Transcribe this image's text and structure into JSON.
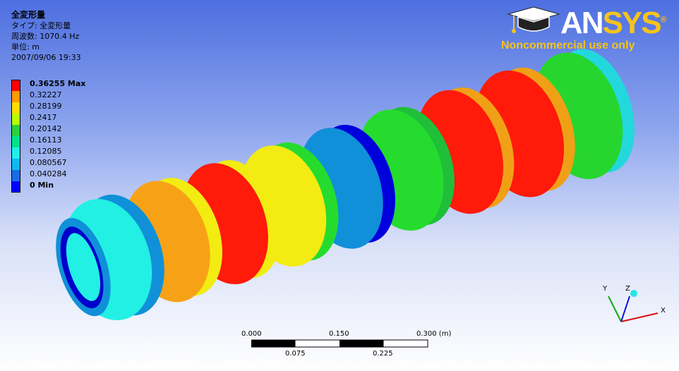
{
  "info": {
    "title": "全変形量",
    "type_line": "タイプ: 全変形量",
    "freq_line": "周波数: 1070.4 Hz",
    "unit_line": "単位: m",
    "date_line": "2007/09/06 19:33"
  },
  "legend": [
    {
      "label": "0.36255 Max",
      "color": "#ff0000"
    },
    {
      "label": "0.32227",
      "color": "#ff9a00"
    },
    {
      "label": "0.28199",
      "color": "#ffdd00"
    },
    {
      "label": "0.2417",
      "color": "#b7ff00"
    },
    {
      "label": "0.20142",
      "color": "#2ad23a"
    },
    {
      "label": "0.16113",
      "color": "#00e38a"
    },
    {
      "label": "0.12085",
      "color": "#20f0e6"
    },
    {
      "label": "0.080567",
      "color": "#0fb8f0"
    },
    {
      "label": "0.040284",
      "color": "#1a6ce6"
    },
    {
      "label": "0 Min",
      "color": "#0000ff"
    }
  ],
  "logo": {
    "word_a": "AN",
    "word_b": "SYS",
    "registered": "®",
    "subtitle": "Noncommercial use only"
  },
  "triad": {
    "x": "X",
    "y": "Y",
    "z": "Z"
  },
  "scale_bar": {
    "top_labels": [
      "0.000",
      "0.150",
      "0.300 (m)"
    ],
    "bottom_labels": [
      "0.075",
      "0.225"
    ]
  },
  "colors": {
    "red": "#ff1a0a",
    "orange": "#f7a216",
    "yellow": "#f2ec12",
    "green": "#25dc2e",
    "cyan": "#22f0e4",
    "blue": "#1090d8",
    "darkblue": "#0000dd"
  }
}
